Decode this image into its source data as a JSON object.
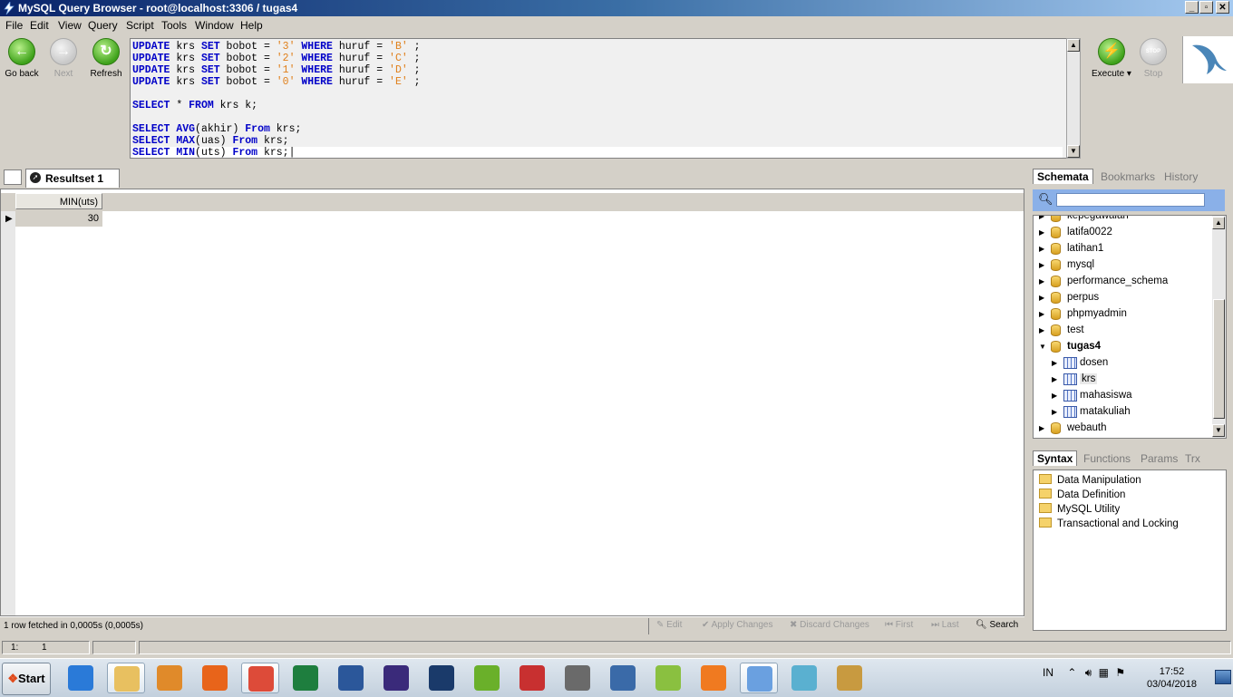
{
  "window": {
    "title": "MySQL Query Browser - root@localhost:3306 / tugas4"
  },
  "menu": [
    "File",
    "Edit",
    "View",
    "Query",
    "Script",
    "Tools",
    "Window",
    "Help"
  ],
  "toolbar": {
    "go_back": "Go back",
    "next": "Next",
    "refresh": "Refresh",
    "execute": "Execute",
    "stop": "Stop",
    "stop_icon_text": "STOP"
  },
  "editor": {
    "lines": [
      [
        "UPDATE",
        " krs ",
        "SET",
        " bobot = ",
        "'3'",
        " ",
        "WHERE",
        " huruf = ",
        "'B'",
        " ;"
      ],
      [
        "UPDATE",
        " krs ",
        "SET",
        " bobot = ",
        "'2'",
        " ",
        "WHERE",
        " huruf = ",
        "'C'",
        " ;"
      ],
      [
        "UPDATE",
        " krs ",
        "SET",
        " bobot = ",
        "'1'",
        " ",
        "WHERE",
        " huruf = ",
        "'D'",
        " ;"
      ],
      [
        "UPDATE",
        " krs ",
        "SET",
        " bobot = ",
        "'0'",
        " ",
        "WHERE",
        " huruf = ",
        "'E'",
        " ;"
      ],
      [
        ""
      ],
      [
        "SELECT",
        " * ",
        "FROM",
        " krs k;"
      ],
      [
        ""
      ],
      [
        "SELECT",
        " ",
        "AVG",
        "(akhir) ",
        "From",
        " krs;"
      ],
      [
        "SELECT",
        " ",
        "MAX",
        "(uas) ",
        "From",
        " krs;"
      ],
      [
        "SELECT",
        " ",
        "MIN",
        "(uts) ",
        "From",
        " krs;"
      ]
    ]
  },
  "result": {
    "tab_label": "Resultset 1",
    "columns": [
      "MIN(uts)"
    ],
    "rows": [
      [
        "30"
      ]
    ],
    "status": "1 row fetched in 0,0005s (0,0005s)",
    "buttons": {
      "edit": "Edit",
      "apply": "Apply Changes",
      "discard": "Discard Changes",
      "first": "First",
      "last": "Last",
      "search": "Search"
    }
  },
  "statusbar": {
    "line": "1:",
    "col": "1"
  },
  "schemata": {
    "tabs": [
      "Schemata",
      "Bookmarks",
      "History"
    ],
    "search_placeholder": "",
    "items": [
      {
        "label": "kepegawaian",
        "type": "db",
        "level": 0
      },
      {
        "label": "latifa0022",
        "type": "db",
        "level": 0
      },
      {
        "label": "latihan1",
        "type": "db",
        "level": 0
      },
      {
        "label": "mysql",
        "type": "db",
        "level": 0
      },
      {
        "label": "performance_schema",
        "type": "db",
        "level": 0
      },
      {
        "label": "perpus",
        "type": "db",
        "level": 0
      },
      {
        "label": "phpmyadmin",
        "type": "db",
        "level": 0
      },
      {
        "label": "test",
        "type": "db",
        "level": 0
      },
      {
        "label": "tugas4",
        "type": "db",
        "level": 0,
        "expanded": true,
        "bold": true
      },
      {
        "label": "dosen",
        "type": "table",
        "level": 1
      },
      {
        "label": "krs",
        "type": "table",
        "level": 1,
        "selected": true
      },
      {
        "label": "mahasiswa",
        "type": "table",
        "level": 1
      },
      {
        "label": "matakuliah",
        "type": "table",
        "level": 1
      },
      {
        "label": "webauth",
        "type": "db",
        "level": 0
      }
    ]
  },
  "syntax": {
    "tabs": [
      "Syntax",
      "Functions",
      "Params",
      "Trx"
    ],
    "items": [
      "Data Manipulation",
      "Data Definition",
      "MySQL Utility",
      "Transactional and Locking"
    ]
  },
  "taskbar": {
    "start": "Start",
    "apps": [
      "internet-explorer",
      "file-explorer",
      "media-player",
      "firefox",
      "chrome",
      "excel",
      "word",
      "eclipse",
      "photoshop",
      "greenfoot",
      "toefl",
      "app-32",
      "screen-capture",
      "android",
      "xampp",
      "mysql-query-browser",
      "notepad",
      "paint"
    ],
    "tray_lang": "IN",
    "time": "17:52",
    "date": "03/04/2018"
  },
  "colors": {
    "keyword": "#0000c8",
    "string": "#e0801c",
    "selection_bg": "#8ab0e8"
  }
}
